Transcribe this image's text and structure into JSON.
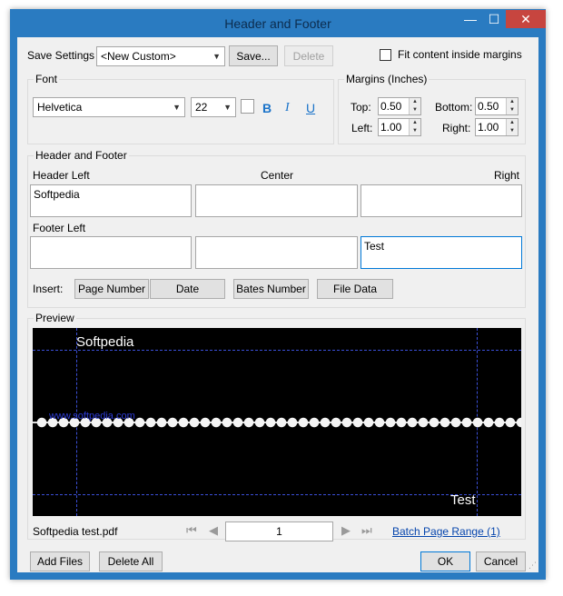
{
  "window": {
    "title": "Header and Footer",
    "minimize_glyph": "—",
    "maximize_glyph": "☐",
    "close_glyph": "✕"
  },
  "save_settings": {
    "label": "Save Settings",
    "preset": "<New Custom>",
    "save_button": "Save...",
    "delete_button": "Delete"
  },
  "fit_content": {
    "label": "Fit content inside margins",
    "checked": false
  },
  "font": {
    "group_label": "Font",
    "family": "Helvetica",
    "size": "22",
    "bold": "B",
    "italic": "I",
    "underline": "U"
  },
  "margins": {
    "group_label": "Margins (Inches)",
    "top_label": "Top:",
    "top_value": "0.50",
    "bottom_label": "Bottom:",
    "bottom_value": "0.50",
    "left_label": "Left:",
    "left_value": "1.00",
    "right_label": "Right:",
    "right_value": "1.00"
  },
  "header_footer": {
    "group_label": "Header and Footer",
    "header_left_label": "Header Left",
    "center_label": "Center",
    "right_label": "Right",
    "header_left": "Softpedia",
    "header_center": "",
    "header_right": "",
    "footer_left_label": "Footer Left",
    "footer_left": "",
    "footer_center": "",
    "footer_right": "Test",
    "insert_label": "Insert:",
    "insert_page_number": "Page Number",
    "insert_date": "Date",
    "insert_bates": "Bates Number",
    "insert_file_data": "File Data"
  },
  "preview": {
    "label": "Preview",
    "header_text": "Softpedia",
    "footer_text": "Test",
    "watermark": "www.softpedia.com"
  },
  "navigation": {
    "file_name": "Softpedia test.pdf",
    "first": "⏮",
    "prev": "◀",
    "page": "1",
    "next": "▶",
    "last": "⏭",
    "batch_link": "Batch Page Range (1)"
  },
  "footer_buttons": {
    "add_files": "Add Files",
    "delete_all": "Delete All",
    "ok": "OK",
    "cancel": "Cancel"
  },
  "colors": {
    "window_frame": "#2a7bc1",
    "close_button": "#c7453f",
    "accent": "#0078d7",
    "link": "#0645ad"
  }
}
